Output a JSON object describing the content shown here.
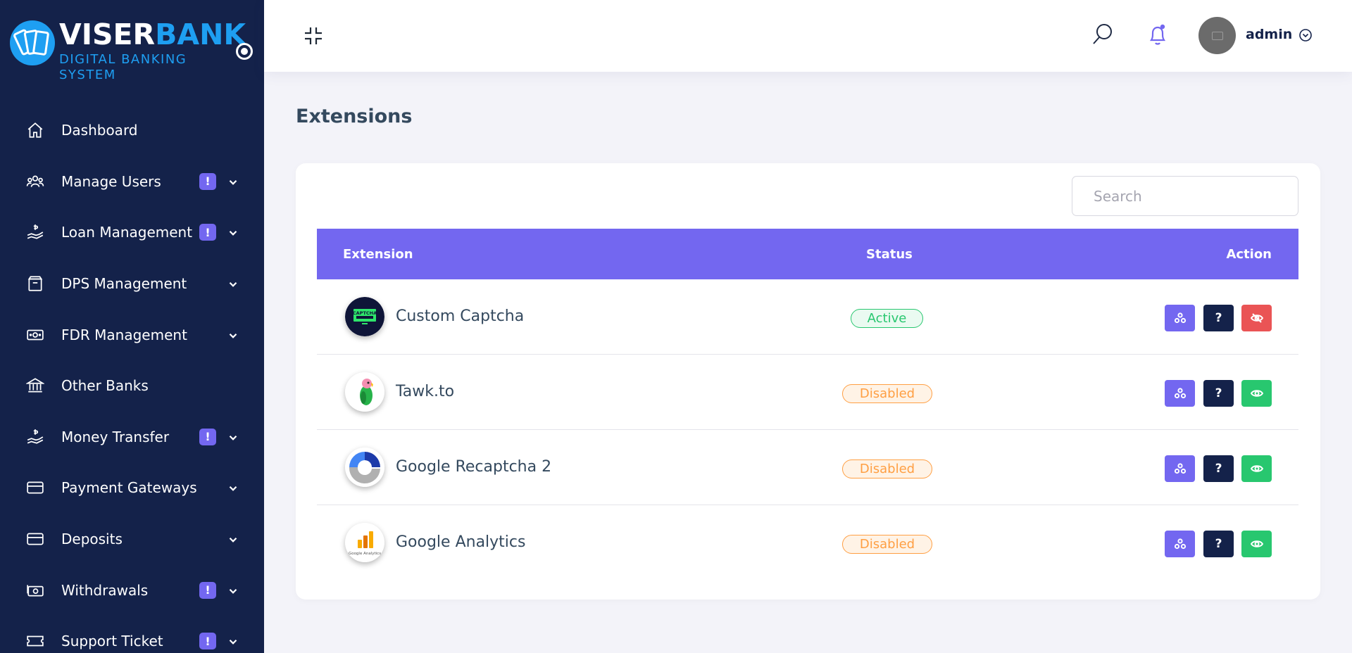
{
  "brand": {
    "name_part1": "VISER",
    "name_part2": "BANK",
    "tagline": "DIGITAL BANKING SYSTEM",
    "primary_color": "#1e9ff2"
  },
  "sidebar": {
    "background": "#14224a",
    "items": [
      {
        "label": "Dashboard",
        "icon": "home-icon",
        "badge": "",
        "chevron": false
      },
      {
        "label": "Manage Users",
        "icon": "users-icon",
        "badge": "!",
        "chevron": true
      },
      {
        "label": "Loan Management",
        "icon": "hand-coin-icon",
        "badge": "!",
        "chevron": true
      },
      {
        "label": "DPS Management",
        "icon": "box-icon",
        "badge": "",
        "chevron": true
      },
      {
        "label": "FDR Management",
        "icon": "money-icon",
        "badge": "",
        "chevron": true
      },
      {
        "label": "Other Banks",
        "icon": "bank-icon",
        "badge": "",
        "chevron": false
      },
      {
        "label": "Money Transfer",
        "icon": "hand-coin-icon",
        "badge": "!",
        "chevron": true
      },
      {
        "label": "Payment Gateways",
        "icon": "card-icon",
        "badge": "",
        "chevron": true
      },
      {
        "label": "Deposits",
        "icon": "card-icon",
        "badge": "",
        "chevron": true
      },
      {
        "label": "Withdrawals",
        "icon": "cash-icon",
        "badge": "!",
        "chevron": true
      },
      {
        "label": "Support Ticket",
        "icon": "ticket-icon",
        "badge": "!",
        "chevron": true
      }
    ]
  },
  "header": {
    "user_name": "admin",
    "accent": "#7367f0"
  },
  "page": {
    "title": "Extensions",
    "search_placeholder": "Search"
  },
  "table": {
    "headers": {
      "extension": "Extension",
      "status": "Status",
      "action": "Action"
    },
    "rows": [
      {
        "name": "Custom Captcha",
        "status": "Active",
        "status_kind": "active",
        "logo": "captcha-logo-icon",
        "enabled": true
      },
      {
        "name": "Tawk.to",
        "status": "Disabled",
        "status_kind": "disabled",
        "logo": "tawkto-parrot-logo-icon",
        "enabled": false
      },
      {
        "name": "Google Recaptcha 2",
        "status": "Disabled",
        "status_kind": "disabled",
        "logo": "recaptcha-logo-icon",
        "enabled": false
      },
      {
        "name": "Google Analytics",
        "status": "Disabled",
        "status_kind": "disabled",
        "logo": "google-analytics-logo-icon",
        "enabled": false
      }
    ]
  },
  "captcha_logo_text": "CAPTCHA",
  "analytics_logo_text": "Google Analytics",
  "colors": {
    "active": "#28c76f",
    "disabled": "#ff9f43",
    "danger": "#ea5455",
    "dark": "#14224a"
  }
}
